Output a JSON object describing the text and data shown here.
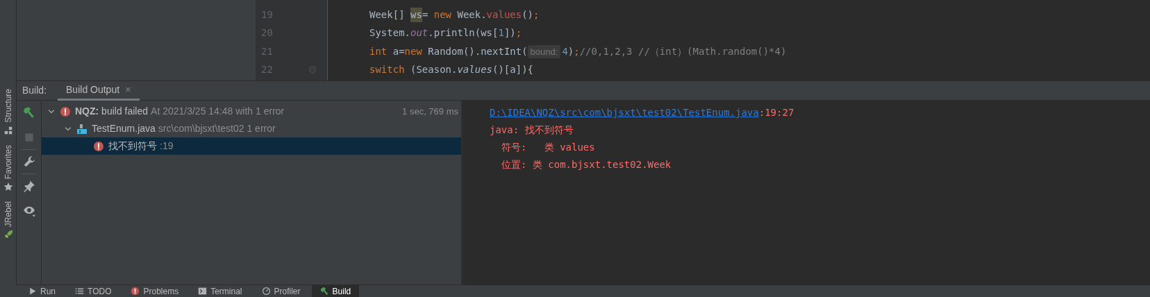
{
  "side_strip": [
    {
      "label": "Structure"
    },
    {
      "label": "Favorites"
    },
    {
      "label": "JRebel"
    }
  ],
  "editor": {
    "lines": [
      {
        "number": "19",
        "fold": false,
        "tokens": [
          {
            "kind": "plain",
            "text": "Week[] "
          },
          {
            "kind": "highlight",
            "text": "ws"
          },
          {
            "kind": "plain",
            "text": "= "
          },
          {
            "kind": "keyword",
            "text": "new"
          },
          {
            "kind": "plain",
            "text": " Week."
          },
          {
            "kind": "method",
            "text": "values"
          },
          {
            "kind": "plain",
            "text": "()"
          },
          {
            "kind": "keyword",
            "text": ";"
          }
        ]
      },
      {
        "number": "20",
        "fold": false,
        "tokens": [
          {
            "kind": "plain",
            "text": "System."
          },
          {
            "kind": "field",
            "text": "out"
          },
          {
            "kind": "plain",
            "text": ".println(ws["
          },
          {
            "kind": "number",
            "text": "1"
          },
          {
            "kind": "plain",
            "text": "])"
          },
          {
            "kind": "keyword",
            "text": ";"
          }
        ]
      },
      {
        "number": "21",
        "fold": false,
        "tokens": [
          {
            "kind": "keyword",
            "text": "int"
          },
          {
            "kind": "plain",
            "text": " a="
          },
          {
            "kind": "keyword",
            "text": "new"
          },
          {
            "kind": "plain",
            "text": " Random().nextInt("
          },
          {
            "kind": "hint",
            "text": "bound:"
          },
          {
            "kind": "number",
            "text": "4"
          },
          {
            "kind": "plain",
            "text": ")"
          },
          {
            "kind": "keyword",
            "text": ";"
          },
          {
            "kind": "comment",
            "text": "//0,1,2,3 //（int）(Math.random()*4)"
          }
        ]
      },
      {
        "number": "22",
        "fold": true,
        "tokens": [
          {
            "kind": "keyword",
            "text": "switch"
          },
          {
            "kind": "plain",
            "text": " (Season."
          },
          {
            "kind": "static",
            "text": "values"
          },
          {
            "kind": "plain",
            "text": "()[a]){"
          }
        ]
      }
    ]
  },
  "build_bar": {
    "label": "Build:",
    "tabs": [
      {
        "label": "Build Output",
        "selected": true
      }
    ],
    "close": "×"
  },
  "tree": [
    {
      "kind": "error",
      "text": "**NQZ:** build failed",
      "detail": "At 2021/3/25 14:48 with 1 error",
      "time": "1 sec, 769 ms",
      "expanded": true,
      "selected": false,
      "children": [
        {
          "kind": "file",
          "text": "TestEnum.java",
          "detail": "src\\com\\bjsxt\\test02 1 error",
          "expanded": true,
          "selected": false,
          "children": [
            {
              "kind": "error",
              "text": "找不到符号",
              "detail": ":19",
              "selected": true
            }
          ]
        }
      ]
    }
  ],
  "console": [
    {
      "kind": "link",
      "text": "D:\\IDEA\\NQZ\\src\\com\\bjsxt\\test02\\TestEnum.java",
      "suffix": ":19:27"
    },
    {
      "kind": "error",
      "text": "java: 找不到符号"
    },
    {
      "kind": "detail",
      "text": "符号:   类 values"
    },
    {
      "kind": "detail",
      "text": "位置: 类 com.bjsxt.test02.Week"
    }
  ],
  "bottom_tabs": [
    {
      "label": "Run",
      "selected": false
    },
    {
      "label": "TODO",
      "selected": false
    },
    {
      "label": "Problems",
      "selected": false
    },
    {
      "label": "Terminal",
      "selected": false
    },
    {
      "label": "Profiler",
      "selected": false
    },
    {
      "label": "Build",
      "selected": true
    }
  ]
}
